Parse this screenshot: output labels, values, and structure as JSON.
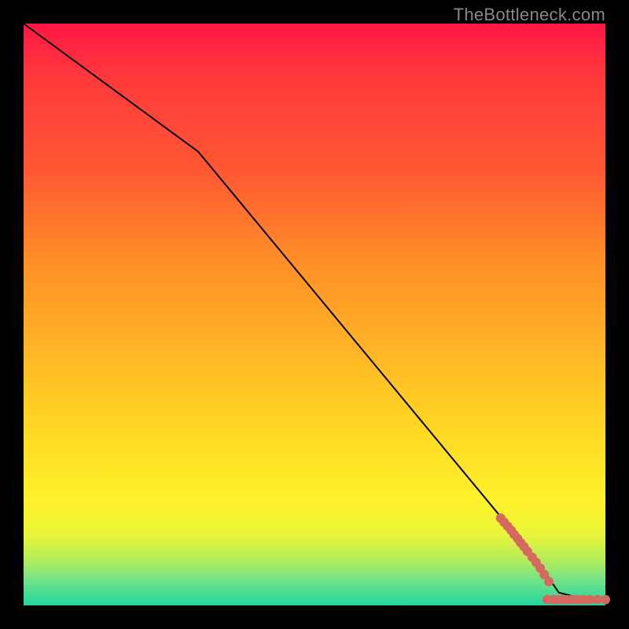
{
  "attribution": "TheBottleneck.com",
  "colors": {
    "gradient_top": "#ff1744",
    "gradient_bottom": "#1fd7a0",
    "curve": "#000000",
    "dot": "#d6695f",
    "background": "#000000"
  },
  "chart_data": {
    "type": "line",
    "title": "",
    "xlabel": "",
    "ylabel": "",
    "xlim": [
      0,
      100
    ],
    "ylim": [
      0,
      100
    ],
    "grid": false,
    "legend": false,
    "curve": [
      {
        "x": 0,
        "y": 100
      },
      {
        "x": 30,
        "y": 78
      },
      {
        "x": 88,
        "y": 8
      },
      {
        "x": 92,
        "y": 2.2
      },
      {
        "x": 96,
        "y": 1.2
      },
      {
        "x": 100,
        "y": 1.0
      }
    ],
    "scatter": [
      {
        "x": 82.0,
        "y": 15.0
      },
      {
        "x": 82.6,
        "y": 14.3
      },
      {
        "x": 83.2,
        "y": 13.6
      },
      {
        "x": 83.8,
        "y": 12.9
      },
      {
        "x": 84.3,
        "y": 12.2
      },
      {
        "x": 84.9,
        "y": 11.5
      },
      {
        "x": 85.4,
        "y": 10.8
      },
      {
        "x": 86.0,
        "y": 10.1
      },
      {
        "x": 86.6,
        "y": 9.3
      },
      {
        "x": 87.4,
        "y": 8.3
      },
      {
        "x": 88.1,
        "y": 7.4
      },
      {
        "x": 88.8,
        "y": 6.4
      },
      {
        "x": 89.5,
        "y": 5.3
      },
      {
        "x": 90.3,
        "y": 4.1
      },
      {
        "x": 90.0,
        "y": 1.0
      },
      {
        "x": 91.0,
        "y": 1.0
      },
      {
        "x": 91.8,
        "y": 1.0
      },
      {
        "x": 92.6,
        "y": 1.0
      },
      {
        "x": 93.4,
        "y": 1.0
      },
      {
        "x": 94.2,
        "y": 1.0
      },
      {
        "x": 95.2,
        "y": 1.0
      },
      {
        "x": 96.2,
        "y": 1.0
      },
      {
        "x": 97.3,
        "y": 1.0
      },
      {
        "x": 98.6,
        "y": 1.0
      },
      {
        "x": 100.0,
        "y": 1.0
      }
    ]
  }
}
